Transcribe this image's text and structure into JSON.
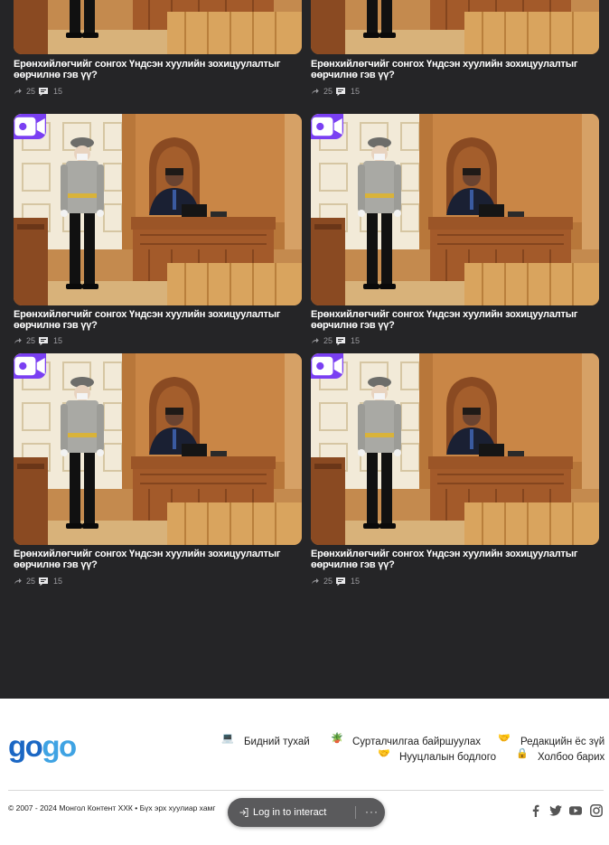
{
  "articles": [
    {
      "title": "Ерөнхийлөгчийг сонгох Үндсэн хуулийн зохицуулалтыг өөрчилнө гэв үү?",
      "shares": "25",
      "comments": "15",
      "badge_icon": "video-camera-icon"
    },
    {
      "title": "Ерөнхийлөгчийг сонгох Үндсэн хуулийн зохицуулалтыг өөрчилнө гэв үү?",
      "shares": "25",
      "comments": "15",
      "badge_icon": "video-camera-icon"
    },
    {
      "title": "Ерөнхийлөгчийг сонгох Үндсэн хуулийн зохицуулалтыг өөрчилнө гэв үү?",
      "shares": "25",
      "comments": "15",
      "badge_icon": "video-camera-icon"
    },
    {
      "title": "Ерөнхийлөгчийг сонгох Үндсэн хуулийн зохицуулалтыг өөрчилнө гэв үү?",
      "shares": "25",
      "comments": "15",
      "badge_icon": "video-camera-icon"
    },
    {
      "title": "Ерөнхийлөгчийг сонгох Үндсэн хуулийн зохицуулалтыг өөрчилнө гэв үү?",
      "shares": "25",
      "comments": "15",
      "badge_icon": "video-camera-icon"
    },
    {
      "title": "Ерөнхийлөгчийг сонгох Үндсэн хуулийн зохицуулалтыг өөрчилнө гэв үү?",
      "shares": "25",
      "comments": "15",
      "badge_icon": "video-camera-icon"
    }
  ],
  "footer": {
    "logo_part1": "go",
    "logo_part2": "go",
    "links": [
      {
        "label": "Бидний тухай",
        "icon": "laptop-icon"
      },
      {
        "label": "Сурталчилгаа байршуулах",
        "icon": "potted-plant-icon"
      },
      {
        "label": "Редакцийн ёс зүй",
        "icon": "handshake-icon"
      },
      {
        "label": "Нууцлалын бодлого",
        "icon": "handshake-icon"
      },
      {
        "label": "Холбоо барих",
        "icon": "lock-icon"
      }
    ],
    "copyright": "© 2007 - 2024 Монгол Контент ХХК • Бүх эрх хуулиар хамг",
    "social": [
      "facebook-icon",
      "twitter-icon",
      "youtube-icon",
      "instagram-icon"
    ]
  },
  "login_prompt": {
    "label": "Log in to interact",
    "more": "···"
  },
  "colors": {
    "background": "#252527",
    "badge": "#7a3ff2",
    "logo_dark": "#1b67c4",
    "logo_light": "#3fa3e3"
  }
}
